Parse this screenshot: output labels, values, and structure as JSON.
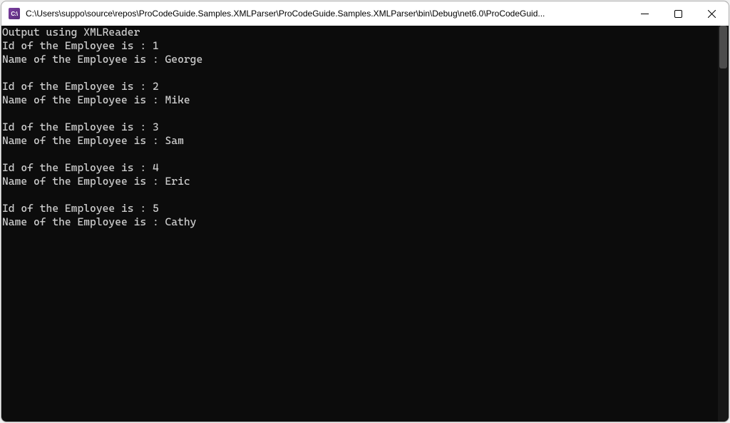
{
  "window": {
    "title": "C:\\Users\\suppo\\source\\repos\\ProCodeGuide.Samples.XMLParser\\ProCodeGuide.Samples.XMLParser\\bin\\Debug\\net6.0\\ProCodeGuid...",
    "icon_text": "C:\\"
  },
  "console": {
    "header_line": "Output using XMLReader",
    "id_label_prefix": "Id of the Employee is : ",
    "name_label_prefix": "Name of the Employee is : ",
    "employees": [
      {
        "id": "1",
        "name": "George"
      },
      {
        "id": "2",
        "name": "Mike"
      },
      {
        "id": "3",
        "name": "Sam"
      },
      {
        "id": "4",
        "name": "Eric"
      },
      {
        "id": "5",
        "name": "Cathy"
      }
    ]
  }
}
